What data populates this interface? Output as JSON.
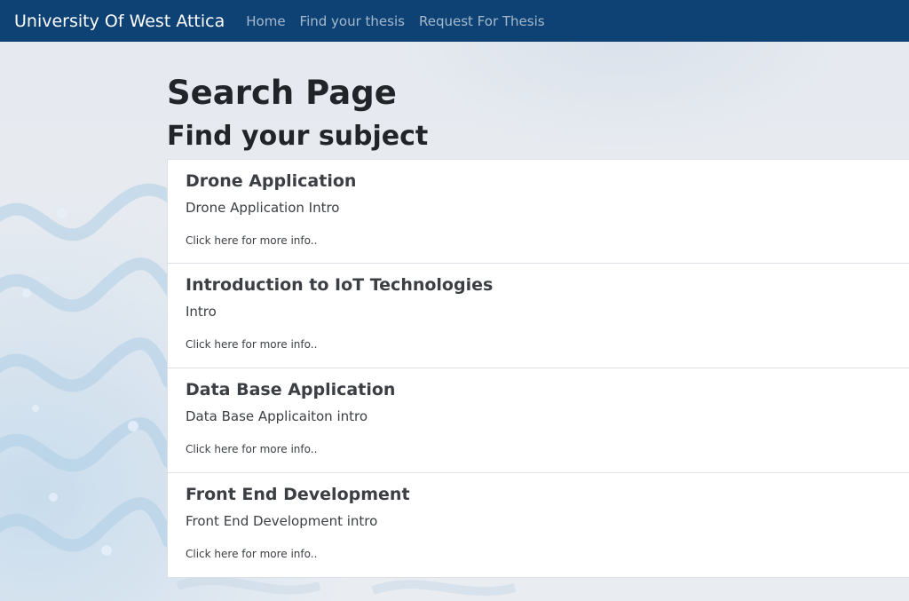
{
  "navbar": {
    "brand": "University Of West Attica",
    "links": [
      "Home",
      "Find your thesis",
      "Request For Thesis"
    ],
    "background": "#0e4275"
  },
  "page": {
    "title": "Search Page",
    "subtitle": "Find your subject"
  },
  "subjects": [
    {
      "title": "Drone Application",
      "intro": "Drone Application Intro",
      "link": "Click here for more info.."
    },
    {
      "title": "Introduction to IoT Technologies",
      "intro": "Intro",
      "link": "Click here for more info.."
    },
    {
      "title": "Data Base Application",
      "intro": "Data Base Applicaiton intro",
      "link": "Click here for more info.."
    },
    {
      "title": "Front End Development",
      "intro": "Front End Development intro",
      "link": "Click here for more info.."
    }
  ]
}
